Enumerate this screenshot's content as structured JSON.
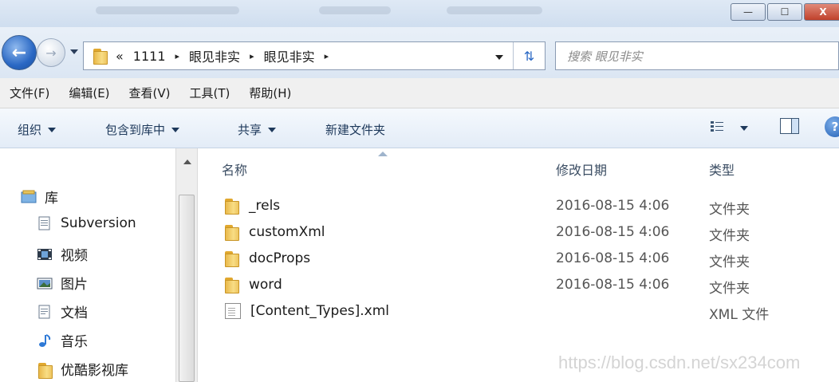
{
  "window": {
    "buttons": {
      "minimize": "—",
      "maximize": "☐",
      "close": "X"
    }
  },
  "address": {
    "overflow": "«",
    "crumbs": [
      "1111",
      "眼见非实",
      "眼见非实"
    ],
    "separator": "▸"
  },
  "search": {
    "placeholder": "搜索 眼见非实"
  },
  "menu": [
    "文件(F)",
    "编辑(E)",
    "查看(V)",
    "工具(T)",
    "帮助(H)"
  ],
  "toolbar": {
    "organize": "组织",
    "include_library": "包含到库中",
    "share": "共享",
    "new_folder": "新建文件夹",
    "help": "?"
  },
  "sidebar": {
    "library": {
      "label": "库",
      "icon": "library-icon"
    },
    "items": [
      {
        "label": "Subversion",
        "icon": "document-icon"
      },
      {
        "label": "视频",
        "icon": "video-icon"
      },
      {
        "label": "图片",
        "icon": "picture-icon"
      },
      {
        "label": "文档",
        "icon": "document-icon"
      },
      {
        "label": "音乐",
        "icon": "music-icon"
      },
      {
        "label": "优酷影视库",
        "icon": "folder-icon"
      }
    ]
  },
  "columns": {
    "name": "名称",
    "date": "修改日期",
    "type": "类型"
  },
  "files": [
    {
      "name": "_rels",
      "date": "2016-08-15 4:06",
      "type": "文件夹",
      "icon": "folder-icon"
    },
    {
      "name": "customXml",
      "date": "2016-08-15 4:06",
      "type": "文件夹",
      "icon": "folder-icon"
    },
    {
      "name": "docProps",
      "date": "2016-08-15 4:06",
      "type": "文件夹",
      "icon": "folder-icon"
    },
    {
      "name": "word",
      "date": "2016-08-15 4:06",
      "type": "文件夹",
      "icon": "folder-icon"
    },
    {
      "name": "[Content_Types].xml",
      "date": "",
      "type": "XML 文件",
      "icon": "file-icon"
    }
  ],
  "watermark": "https://blog.csdn.net/sx234com"
}
